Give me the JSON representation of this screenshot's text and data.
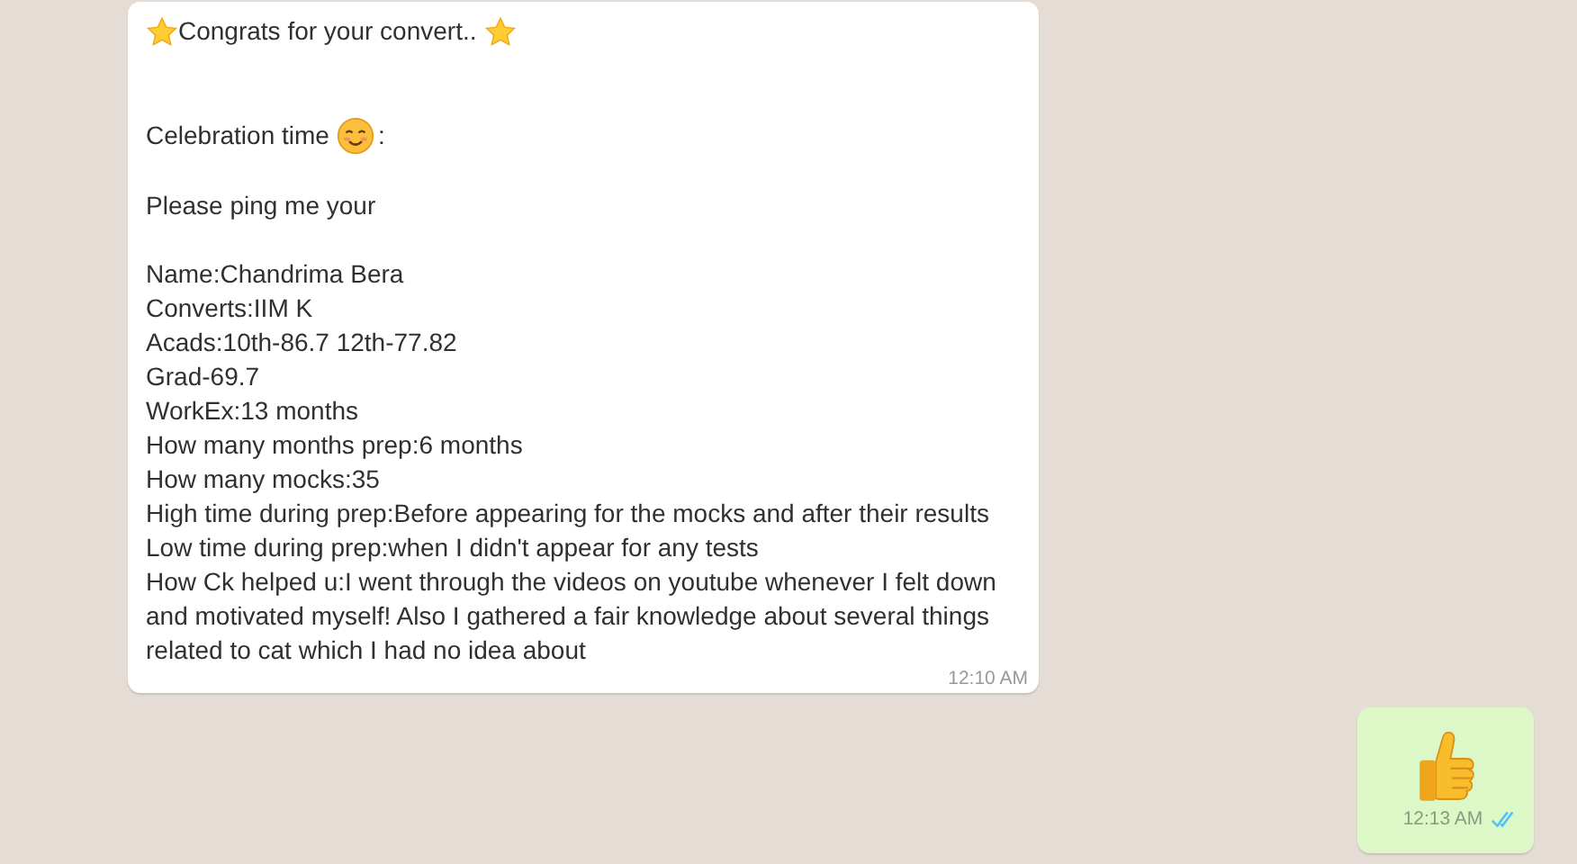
{
  "messages": [
    {
      "kind": "text",
      "time": "12:10 AM",
      "lines": [
        {
          "kind": "starred",
          "text": "Congrats for your convert.."
        },
        {
          "kind": "smiley",
          "text": "Celebration time",
          "suffix": ":"
        },
        {
          "kind": "paragraph",
          "text": "Please ping me your"
        },
        {
          "kind": "line",
          "text": "Name:Chandrima Bera"
        },
        {
          "kind": "line",
          "text": "Converts:IIM K"
        },
        {
          "kind": "line",
          "text": "Acads:10th-86.7 12th-77.82"
        },
        {
          "kind": "line",
          "text": "Grad-69.7"
        },
        {
          "kind": "line",
          "text": "WorkEx:13 months"
        },
        {
          "kind": "line",
          "text": "How many months prep:6 months"
        },
        {
          "kind": "line",
          "text": "How many mocks:35"
        },
        {
          "kind": "line",
          "text": "High time during prep:Before appearing for the mocks and after their results"
        },
        {
          "kind": "line",
          "text": "Low time during prep:when I didn't appear for any tests"
        },
        {
          "kind": "line",
          "text": "How Ck helped u:I went through the videos on youtube whenever I felt down and motivated myself! Also I gathered a fair knowledge about several things related to cat which I had no idea about"
        }
      ]
    },
    {
      "kind": "thumbs_up",
      "time": "12:13 AM",
      "read": true
    }
  ]
}
